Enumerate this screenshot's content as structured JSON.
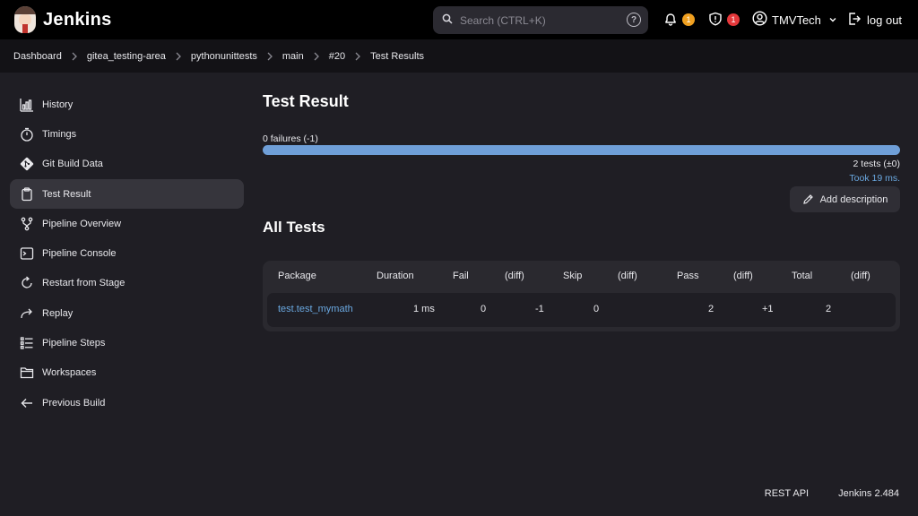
{
  "header": {
    "brand": "Jenkins",
    "search_placeholder": "Search (CTRL+K)",
    "help_glyph": "?",
    "notifications_count": "1",
    "security_count": "1",
    "user": "TMVTech",
    "logout": "log out"
  },
  "breadcrumb": [
    "Dashboard",
    "gitea_testing-area",
    "pythonunittests",
    "main",
    "#20",
    "Test Results"
  ],
  "sidebar": [
    {
      "label": "History",
      "icon": "history-icon"
    },
    {
      "label": "Timings",
      "icon": "timer-icon"
    },
    {
      "label": "Git Build Data",
      "icon": "git-icon"
    },
    {
      "label": "Test Result",
      "icon": "clipboard-icon",
      "active": true
    },
    {
      "label": "Pipeline Overview",
      "icon": "pipeline-icon"
    },
    {
      "label": "Pipeline Console",
      "icon": "terminal-icon"
    },
    {
      "label": "Restart from Stage",
      "icon": "restart-icon"
    },
    {
      "label": "Replay",
      "icon": "replay-icon"
    },
    {
      "label": "Pipeline Steps",
      "icon": "steps-icon"
    },
    {
      "label": "Workspaces",
      "icon": "folder-icon"
    },
    {
      "label": "Previous Build",
      "icon": "arrow-left-icon"
    }
  ],
  "main": {
    "title": "Test Result",
    "failures": "0 failures (-1)",
    "progress_pass_fraction": 1.0,
    "tests": "2 tests (±0)",
    "took": "Took 19 ms.",
    "add_description": "Add description",
    "all_tests": "All Tests",
    "columns": [
      "Package",
      "Duration",
      "Fail",
      "(diff)",
      "Skip",
      "(diff)",
      "Pass",
      "(diff)",
      "Total",
      "(diff)"
    ],
    "rows": [
      {
        "package": "test.test_mymath",
        "duration": "1 ms",
        "fail": "0",
        "fail_diff": "-1",
        "skip": "0",
        "skip_diff": "",
        "pass": "2",
        "pass_diff": "+1",
        "total": "2",
        "total_diff": ""
      }
    ]
  },
  "footer": {
    "rest_api": "REST API",
    "version": "Jenkins 2.484"
  },
  "colors": {
    "accent": "#6aa8e0",
    "progress": "#6f9fd8",
    "badge_orange": "#f0a020",
    "badge_red": "#e5383b"
  }
}
